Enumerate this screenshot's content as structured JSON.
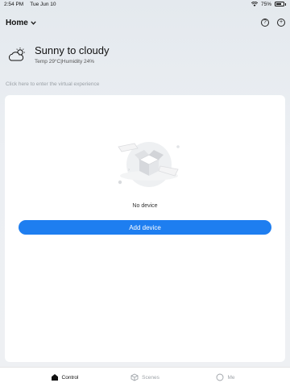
{
  "status_bar": {
    "time": "2:54 PM",
    "date": "Tue Jun 10",
    "battery": "75%"
  },
  "header": {
    "home_label": "Home",
    "help_icon": "question-circle-icon",
    "add_icon": "plus-circle-icon"
  },
  "weather": {
    "icon": "partly-sunny-cloud-icon",
    "condition": "Sunny to cloudy",
    "details": "Temp 29°C|Humidity 24%"
  },
  "virtual_link": "Click here to enter the virtual experience",
  "empty_state": {
    "illustration": "empty-box-illustration",
    "message": "No device",
    "button_label": "Add device"
  },
  "tabs": [
    {
      "label": "Control",
      "icon": "home-icon",
      "active": true
    },
    {
      "label": "Scenes",
      "icon": "scenes-cube-icon",
      "active": false
    },
    {
      "label": "Me",
      "icon": "profile-circle-icon",
      "active": false
    }
  ],
  "colors": {
    "accent": "#1e7ef0",
    "background": "#eceff3",
    "card": "#ffffff"
  }
}
